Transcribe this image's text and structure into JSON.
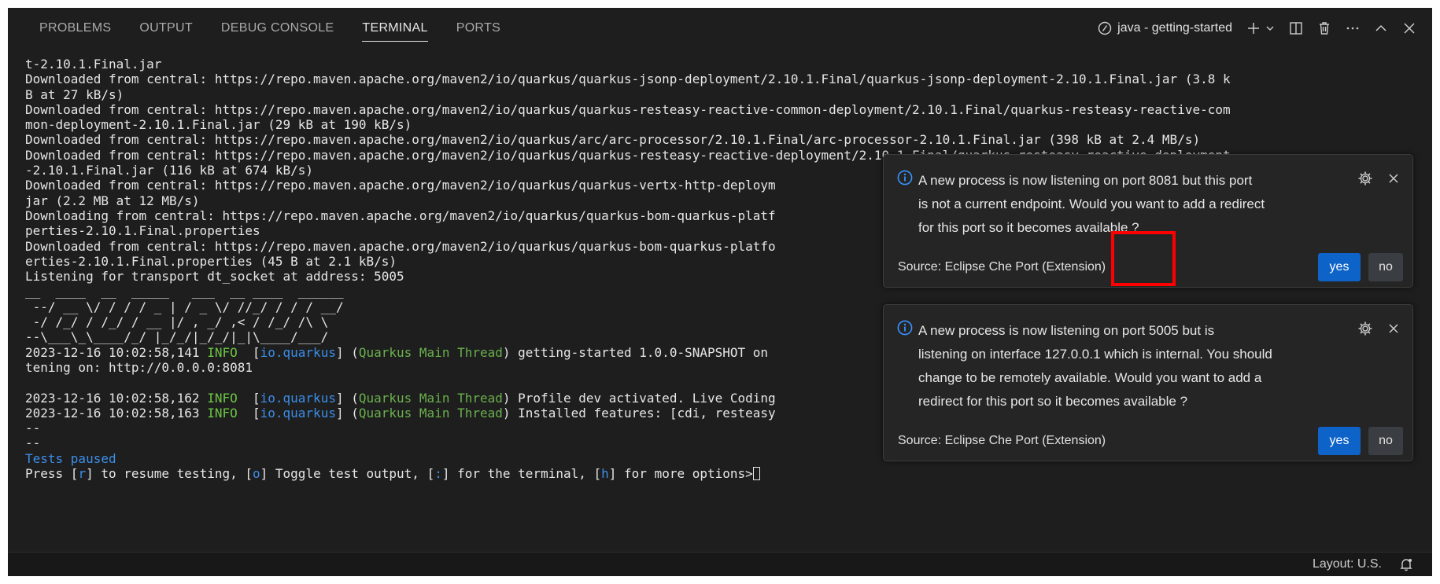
{
  "tabs": [
    {
      "label": "PROBLEMS",
      "active": false
    },
    {
      "label": "OUTPUT",
      "active": false
    },
    {
      "label": "DEBUG CONSOLE",
      "active": false
    },
    {
      "label": "TERMINAL",
      "active": true
    },
    {
      "label": "PORTS",
      "active": false
    }
  ],
  "terminal_header": {
    "name": "java - getting-started",
    "icons": [
      "terminal-java-icon",
      "new-terminal-plus-icon",
      "chevron-down-icon",
      "split-terminal-icon",
      "trash-icon",
      "more-actions-icon",
      "maximize-chevron-up-icon",
      "close-panel-icon"
    ]
  },
  "terminal_lines": [
    {
      "parts": [
        {
          "t": "t-2.10.1.Final.jar"
        }
      ]
    },
    {
      "parts": [
        {
          "t": "Downloaded from central: https://repo.maven.apache.org/maven2/io/quarkus/quarkus-jsonp-deployment/2.10.1.Final/quarkus-jsonp-deployment-2.10.1.Final.jar (3.8 k"
        }
      ]
    },
    {
      "parts": [
        {
          "t": "B at 27 kB/s)"
        }
      ]
    },
    {
      "parts": [
        {
          "t": "Downloaded from central: https://repo.maven.apache.org/maven2/io/quarkus/quarkus-resteasy-reactive-common-deployment/2.10.1.Final/quarkus-resteasy-reactive-com"
        }
      ]
    },
    {
      "parts": [
        {
          "t": "mon-deployment-2.10.1.Final.jar (29 kB at 190 kB/s)"
        }
      ]
    },
    {
      "parts": [
        {
          "t": "Downloaded from central: https://repo.maven.apache.org/maven2/io/quarkus/arc/arc-processor/2.10.1.Final/arc-processor-2.10.1.Final.jar (398 kB at 2.4 MB/s)"
        }
      ]
    },
    {
      "parts": [
        {
          "t": "Downloaded from central: https://repo.maven.apache.org/maven2/io/quarkus/quarkus-resteasy-reactive-deployment/2.10.1.Final/quarkus-resteasy-reactive-deployment"
        }
      ]
    },
    {
      "parts": [
        {
          "t": "-2.10.1.Final.jar (116 kB at 674 kB/s)"
        }
      ]
    },
    {
      "parts": [
        {
          "t": "Downloaded from central: https://repo.maven.apache.org/maven2/io/quarkus/quarkus-vertx-http-deploym"
        }
      ]
    },
    {
      "parts": [
        {
          "t": "jar (2.2 MB at 12 MB/s)"
        }
      ]
    },
    {
      "parts": [
        {
          "t": "Downloading from central: https://repo.maven.apache.org/maven2/io/quarkus/quarkus-bom-quarkus-platf"
        }
      ]
    },
    {
      "parts": [
        {
          "t": "perties-2.10.1.Final.properties"
        }
      ]
    },
    {
      "parts": [
        {
          "t": "Downloaded from central: https://repo.maven.apache.org/maven2/io/quarkus/quarkus-bom-quarkus-platfo"
        }
      ]
    },
    {
      "parts": [
        {
          "t": "erties-2.10.1.Final.properties (45 B at 2.1 kB/s)"
        }
      ]
    },
    {
      "parts": [
        {
          "t": "Listening for transport dt_socket at address: 5005"
        }
      ]
    },
    {
      "parts": [
        {
          "t": "__  ____  __  _____   ___  __ ____  ______ "
        }
      ]
    },
    {
      "parts": [
        {
          "t": " --/ __ \\/ / / / _ | / _ \\/ //_/ / / / __/ "
        }
      ]
    },
    {
      "parts": [
        {
          "t": " -/ /_/ / /_/ / __ |/ , _/ ,< / /_/ /\\ \\   "
        }
      ]
    },
    {
      "parts": [
        {
          "t": "--\\___\\_\\____/_/ |_/_/|_/_/|_|\\____/___/   "
        }
      ]
    },
    {
      "parts": [
        {
          "t": "2023-12-16 10:02:58,141 "
        },
        {
          "t": "INFO",
          "c": "info"
        },
        {
          "t": "  ["
        },
        {
          "t": "io.quarkus",
          "c": "blue"
        },
        {
          "t": "] ("
        },
        {
          "t": "Quarkus Main Thread",
          "c": "green"
        },
        {
          "t": ") getting-started 1.0.0-SNAPSHOT on"
        }
      ]
    },
    {
      "parts": [
        {
          "t": "tening on: http://0.0.0.0:8081"
        }
      ]
    },
    {
      "parts": [
        {
          "t": ""
        }
      ]
    },
    {
      "parts": [
        {
          "t": "2023-12-16 10:02:58,162 "
        },
        {
          "t": "INFO",
          "c": "info"
        },
        {
          "t": "  ["
        },
        {
          "t": "io.quarkus",
          "c": "blue"
        },
        {
          "t": "] ("
        },
        {
          "t": "Quarkus Main Thread",
          "c": "green"
        },
        {
          "t": ") Profile dev activated. Live Coding"
        }
      ]
    },
    {
      "parts": [
        {
          "t": "2023-12-16 10:02:58,163 "
        },
        {
          "t": "INFO",
          "c": "info"
        },
        {
          "t": "  ["
        },
        {
          "t": "io.quarkus",
          "c": "blue"
        },
        {
          "t": "] ("
        },
        {
          "t": "Quarkus Main Thread",
          "c": "green"
        },
        {
          "t": ") Installed features: [cdi, resteasy"
        }
      ]
    },
    {
      "parts": [
        {
          "t": "--"
        }
      ]
    },
    {
      "parts": [
        {
          "t": "--"
        }
      ]
    },
    {
      "parts": [
        {
          "t": "Tests paused",
          "c": "cyan"
        }
      ]
    },
    {
      "parts": [
        {
          "t": "Press ["
        },
        {
          "t": "r",
          "c": "cyan"
        },
        {
          "t": "] to resume testing, ["
        },
        {
          "t": "o",
          "c": "cyan"
        },
        {
          "t": "] Toggle test output, ["
        },
        {
          "t": ":",
          "c": "cyan"
        },
        {
          "t": "] for the terminal, ["
        },
        {
          "t": "h",
          "c": "cyan"
        },
        {
          "t": "] for more options>"
        },
        {
          "cursor": true
        }
      ]
    }
  ],
  "notifications": [
    {
      "message_lines": [
        "A new process is now listening on port 8081 but this port",
        "is not a current endpoint. Would you want to add a redirect",
        "for this port so it becomes available ?"
      ],
      "source": "Source: Eclipse Che Port (Extension)",
      "yes_label": "yes",
      "no_label": "no"
    },
    {
      "message_lines": [
        "A new process is now listening on port 5005 but is",
        "listening on interface 127.0.0.1 which is internal. You should",
        "change to be remotely available. Would you want to add a",
        "redirect for this port so it becomes available ?"
      ],
      "source": "Source: Eclipse Che Port (Extension)",
      "yes_label": "yes",
      "no_label": "no"
    }
  ],
  "statusbar": {
    "layout": "Layout: U.S.",
    "icons": [
      "bell-icon"
    ]
  },
  "colors": {
    "background": "#1e1e1e",
    "primary_button": "#0e63c8",
    "secondary_button": "#3a3d41",
    "info_log": "#6cc644",
    "logger_blue": "#3b8eea",
    "thread_green": "#6ab04c",
    "highlight_box": "#ff0000"
  }
}
